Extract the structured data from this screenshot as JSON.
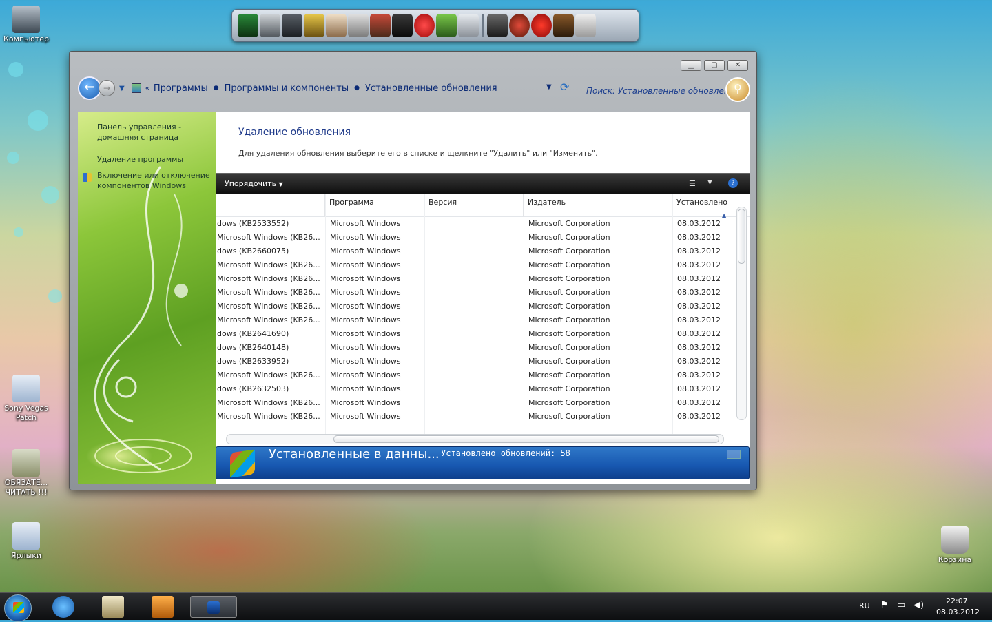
{
  "desktop": {
    "icons": [
      {
        "label": "Компьютер"
      },
      {
        "label": "Sony Vegas Patch"
      },
      {
        "label": "ОБЯЗАТЕ... ЧИТАТЬ !!!"
      },
      {
        "label": "Ярлыки"
      },
      {
        "label": "Корзина"
      }
    ]
  },
  "window": {
    "buttons": {
      "minimize": "▁",
      "maximize": "▢",
      "close": "✕"
    },
    "breadcrumb": {
      "lead": "«",
      "items": [
        "Программы",
        "Программы и компоненты",
        "Установленные обновления"
      ]
    },
    "search_placeholder": "Поиск: Установленные обновления",
    "sidebar": {
      "items": [
        {
          "label": "Панель управления - домашняя страница"
        },
        {
          "label": "Удаление программы"
        },
        {
          "label": "Включение или отключение компонентов Windows"
        }
      ]
    },
    "title": "Удаление обновления",
    "description": "Для удаления обновления выберите его в списке и щелкните \"Удалить\" или \"Изменить\".",
    "toolbar": {
      "organize": "Упорядочить"
    },
    "table": {
      "columns": [
        "Программа",
        "Версия",
        "Издатель",
        "Установлено"
      ],
      "rows": [
        {
          "name": "dows (KB2533552)",
          "program": "Microsoft Windows",
          "version": "",
          "publisher": "Microsoft Corporation",
          "installed": "08.03.2012"
        },
        {
          "name": "Microsoft Windows (KB26...",
          "program": "Microsoft Windows",
          "version": "",
          "publisher": "Microsoft Corporation",
          "installed": "08.03.2012"
        },
        {
          "name": "dows (KB2660075)",
          "program": "Microsoft Windows",
          "version": "",
          "publisher": "Microsoft Corporation",
          "installed": "08.03.2012"
        },
        {
          "name": "Microsoft Windows (KB26...",
          "program": "Microsoft Windows",
          "version": "",
          "publisher": "Microsoft Corporation",
          "installed": "08.03.2012"
        },
        {
          "name": "Microsoft Windows (KB26...",
          "program": "Microsoft Windows",
          "version": "",
          "publisher": "Microsoft Corporation",
          "installed": "08.03.2012"
        },
        {
          "name": "Microsoft Windows (KB26...",
          "program": "Microsoft Windows",
          "version": "",
          "publisher": "Microsoft Corporation",
          "installed": "08.03.2012"
        },
        {
          "name": "Microsoft Windows (KB26...",
          "program": "Microsoft Windows",
          "version": "",
          "publisher": "Microsoft Corporation",
          "installed": "08.03.2012"
        },
        {
          "name": "Microsoft Windows (KB26...",
          "program": "Microsoft Windows",
          "version": "",
          "publisher": "Microsoft Corporation",
          "installed": "08.03.2012"
        },
        {
          "name": "dows (KB2641690)",
          "program": "Microsoft Windows",
          "version": "",
          "publisher": "Microsoft Corporation",
          "installed": "08.03.2012"
        },
        {
          "name": "dows (KB2640148)",
          "program": "Microsoft Windows",
          "version": "",
          "publisher": "Microsoft Corporation",
          "installed": "08.03.2012"
        },
        {
          "name": "dows (KB2633952)",
          "program": "Microsoft Windows",
          "version": "",
          "publisher": "Microsoft Corporation",
          "installed": "08.03.2012"
        },
        {
          "name": "Microsoft Windows (KB26...",
          "program": "Microsoft Windows",
          "version": "",
          "publisher": "Microsoft Corporation",
          "installed": "08.03.2012"
        },
        {
          "name": "dows (KB2632503)",
          "program": "Microsoft Windows",
          "version": "",
          "publisher": "Microsoft Corporation",
          "installed": "08.03.2012"
        },
        {
          "name": "Microsoft Windows (KB26...",
          "program": "Microsoft Windows",
          "version": "",
          "publisher": "Microsoft Corporation",
          "installed": "08.03.2012"
        },
        {
          "name": "Microsoft Windows (KB26...",
          "program": "Microsoft Windows",
          "version": "",
          "publisher": "Microsoft Corporation",
          "installed": "08.03.2012"
        }
      ]
    },
    "details": {
      "title": "Установленные в данны...",
      "count": "Установлено обновлений: 58"
    }
  },
  "taskbar": {
    "language": "RU",
    "time": "22:07",
    "date": "08.03.2012"
  },
  "colors": {
    "accent": "#1f3a8a",
    "details_bar": "#1757b0",
    "sidebar_green": "#6aad26"
  }
}
